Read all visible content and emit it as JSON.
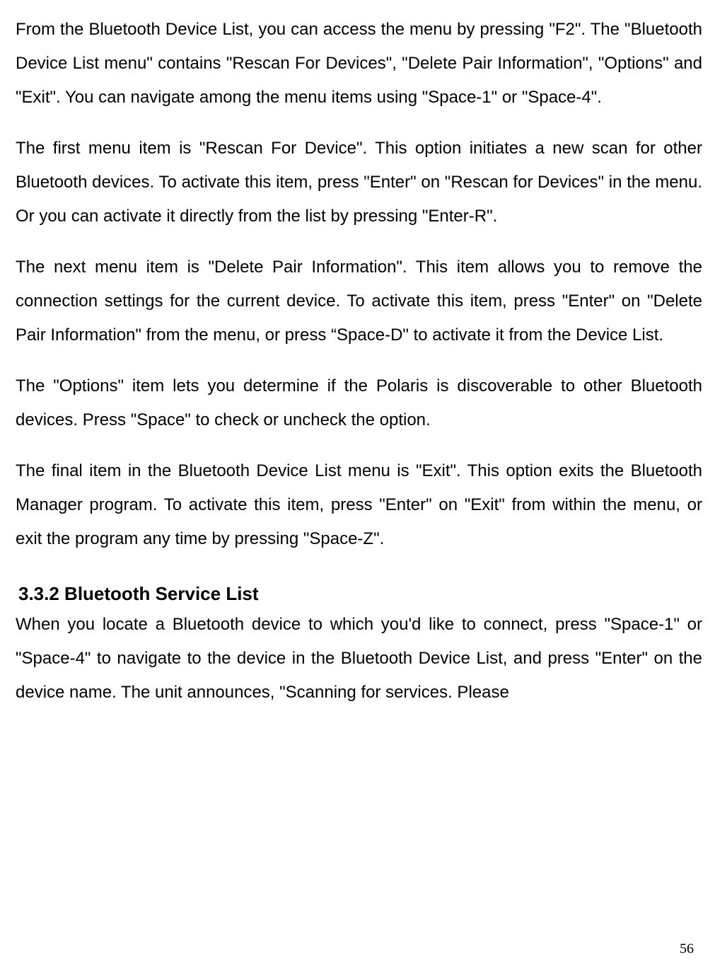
{
  "paragraphs": {
    "p1": "From the Bluetooth Device List, you can access the menu by pressing \"F2\". The \"Bluetooth Device List menu\" contains \"Rescan For Devices\", \"Delete Pair Information\", \"Options\" and \"Exit\". You can navigate among the menu items using \"Space-1\" or \"Space-4\".",
    "p2": "The first menu item is \"Rescan For Device\". This option initiates a new scan for other Bluetooth devices. To activate this item, press \"Enter\" on \"Rescan for Devices\" in the menu. Or you can activate it directly from the list by pressing \"Enter-R\".",
    "p3": "The next menu item is \"Delete Pair Information\". This item allows you to remove the connection settings for the current device. To activate this item, press \"Enter\" on \"Delete Pair Information\" from the menu, or press “Space-D\" to activate it from the Device List.",
    "p4": "The \"Options\" item lets you determine if the Polaris is discoverable to other Bluetooth devices. Press \"Space\" to check or uncheck the option.",
    "p5": "The final item in the Bluetooth Device List menu is \"Exit\". This option exits the Bluetooth Manager program. To activate this item, press \"Enter\" on \"Exit\" from within the menu, or exit the program any time by pressing \"Space-Z\".",
    "p6": "When you locate a Bluetooth device to which you'd like to connect, press \"Space-1\" or \"Space-4\" to navigate to the device in the Bluetooth Device List, and press \"Enter\" on the device name. The unit announces, \"Scanning for services. Please"
  },
  "heading": {
    "h1": "3.3.2 Bluetooth Service List"
  },
  "page_number": "56"
}
